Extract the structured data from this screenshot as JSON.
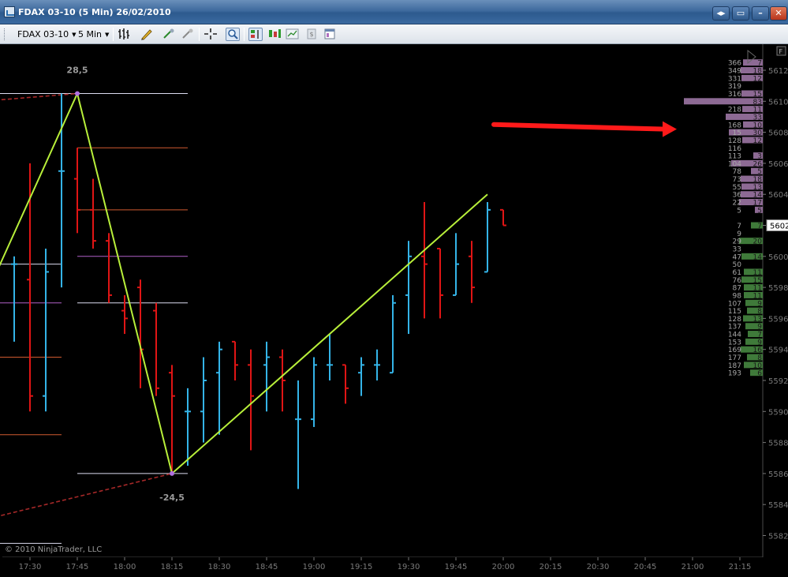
{
  "window": {
    "title": "FDAX 03-10 (5 Min)  26/02/2010",
    "buttons": [
      "◂▸",
      "▭",
      "–",
      "✕"
    ]
  },
  "toolbar": {
    "instrument": "FDAX 03-10",
    "interval": "5 Min"
  },
  "copyright": "© 2010 NinjaTrader, LLC",
  "colors": {
    "up_bar": "#34b4e8",
    "down_bar": "#e01515",
    "zigzag": "#b8ef3a",
    "trend_dash": "#a52828",
    "level_white": "#dcdcf0",
    "level_orange": "#d05a30",
    "level_purple": "#b060c8",
    "arrow": "#ff1a1a",
    "vol_ask": "#8d6a94",
    "vol_bid": "#3f7a3a",
    "axis_text": "#7a7a7a"
  },
  "chart_data": {
    "type": "bar",
    "style": "OHLC",
    "x_ticks": [
      "17:30",
      "17:45",
      "18:00",
      "18:15",
      "18:30",
      "18:45",
      "19:00",
      "19:15",
      "19:30",
      "19:45",
      "20:00",
      "20:15",
      "20:30",
      "20:45",
      "21:00",
      "21:15"
    ],
    "y_ticks": [
      "5612",
      "5610",
      "5608",
      "5606",
      "5604",
      "5602",
      "5600",
      "5598",
      "5596",
      "5594",
      "5592",
      "5590",
      "5588",
      "5586",
      "5584",
      "5582"
    ],
    "ylim": [
      5581.2,
      5612.7
    ],
    "current_price": "5602",
    "bars": [
      {
        "t": "17:25",
        "o": 5599.5,
        "h": 5600.0,
        "l": 5594.5,
        "c": 5599.5
      },
      {
        "t": "17:30",
        "o": 5598.5,
        "h": 5606.0,
        "l": 5590.0,
        "c": 5591.0
      },
      {
        "t": "17:35",
        "o": 5591.0,
        "h": 5600.5,
        "l": 5590.0,
        "c": 5599.0
      },
      {
        "t": "17:40",
        "o": 5605.5,
        "h": 5610.5,
        "l": 5598.0,
        "c": 5605.5
      },
      {
        "t": "17:45",
        "o": 5605.0,
        "h": 5607.0,
        "l": 5601.5,
        "c": 5603.0
      },
      {
        "t": "17:50",
        "o": 5603.0,
        "h": 5605.0,
        "l": 5600.5,
        "c": 5601.0
      },
      {
        "t": "17:55",
        "o": 5601.0,
        "h": 5601.5,
        "l": 5597.0,
        "c": 5597.5
      },
      {
        "t": "18:00",
        "o": 5596.5,
        "h": 5597.5,
        "l": 5595.0,
        "c": 5596.0
      },
      {
        "t": "18:05",
        "o": 5598.0,
        "h": 5598.5,
        "l": 5591.5,
        "c": 5594.0
      },
      {
        "t": "18:10",
        "o": 5596.5,
        "h": 5597.0,
        "l": 5591.0,
        "c": 5591.5
      },
      {
        "t": "18:15",
        "o": 5592.5,
        "h": 5593.0,
        "l": 5586.0,
        "c": 5591.0
      },
      {
        "t": "18:20",
        "o": 5590.0,
        "h": 5591.5,
        "l": 5586.5,
        "c": 5590.0
      },
      {
        "t": "18:25",
        "o": 5590.0,
        "h": 5593.5,
        "l": 5588.0,
        "c": 5592.0
      },
      {
        "t": "18:30",
        "o": 5592.5,
        "h": 5594.5,
        "l": 5588.5,
        "c": 5594.0
      },
      {
        "t": "18:35",
        "o": 5594.5,
        "h": 5594.5,
        "l": 5592.0,
        "c": 5593.0
      },
      {
        "t": "18:40",
        "o": 5593.0,
        "h": 5594.0,
        "l": 5587.5,
        "c": 5591.0
      },
      {
        "t": "18:45",
        "o": 5593.0,
        "h": 5594.5,
        "l": 5590.0,
        "c": 5593.5
      },
      {
        "t": "18:50",
        "o": 5593.5,
        "h": 5594.0,
        "l": 5590.0,
        "c": 5592.0
      },
      {
        "t": "18:55",
        "o": 5589.5,
        "h": 5592.0,
        "l": 5585.0,
        "c": 5589.5
      },
      {
        "t": "19:00",
        "o": 5589.5,
        "h": 5593.5,
        "l": 5589.0,
        "c": 5593.0
      },
      {
        "t": "19:05",
        "o": 5593.0,
        "h": 5595.0,
        "l": 5592.0,
        "c": 5593.0
      },
      {
        "t": "19:10",
        "o": 5593.0,
        "h": 5593.0,
        "l": 5590.5,
        "c": 5591.5
      },
      {
        "t": "19:15",
        "o": 5592.5,
        "h": 5593.5,
        "l": 5591.0,
        "c": 5593.0
      },
      {
        "t": "19:20",
        "o": 5593.0,
        "h": 5594.0,
        "l": 5592.0,
        "c": 5593.0
      },
      {
        "t": "19:25",
        "o": 5592.5,
        "h": 5597.5,
        "l": 5592.5,
        "c": 5597.0
      },
      {
        "t": "19:30",
        "o": 5597.5,
        "h": 5601.0,
        "l": 5595.0,
        "c": 5600.0
      },
      {
        "t": "19:35",
        "o": 5600.0,
        "h": 5603.5,
        "l": 5596.0,
        "c": 5599.5
      },
      {
        "t": "19:40",
        "o": 5600.5,
        "h": 5600.5,
        "l": 5596.0,
        "c": 5597.5
      },
      {
        "t": "19:45",
        "o": 5597.5,
        "h": 5601.5,
        "l": 5597.5,
        "c": 5599.5
      },
      {
        "t": "19:50",
        "o": 5600.0,
        "h": 5601.0,
        "l": 5597.0,
        "c": 5598.0
      },
      {
        "t": "19:55",
        "o": 5599.0,
        "h": 5603.5,
        "l": 5599.0,
        "c": 5603.0
      },
      {
        "t": "20:00",
        "o": 5603.0,
        "h": 5603.0,
        "l": 5602.0,
        "c": 5602.0
      }
    ],
    "zigzag": {
      "points": [
        [
          "17:15",
          5597.0
        ],
        [
          "17:45",
          5610.5
        ],
        [
          "18:15",
          5586.0
        ],
        [
          "19:55",
          5604.0
        ]
      ],
      "labels": [
        {
          "at": "17:45",
          "value": "28,5"
        },
        {
          "at": "18:15",
          "value": "-24,5"
        }
      ]
    },
    "levels": [
      {
        "price": 5610.5,
        "from": "17:15",
        "to": "18:20",
        "color": "white"
      },
      {
        "price": 5599.5,
        "from": "17:15",
        "to": "17:40",
        "color": "white"
      },
      {
        "price": 5597.0,
        "from": "17:15",
        "to": "17:40",
        "color": "purple"
      },
      {
        "price": 5593.5,
        "from": "17:15",
        "to": "17:40",
        "color": "orange"
      },
      {
        "price": 5588.5,
        "from": "17:15",
        "to": "17:40",
        "color": "orange"
      },
      {
        "price": 5581.5,
        "from": "17:15",
        "to": "17:40",
        "color": "white"
      },
      {
        "price": 5607.0,
        "from": "17:45",
        "to": "18:20",
        "color": "orange"
      },
      {
        "price": 5603.0,
        "from": "17:45",
        "to": "18:20",
        "color": "orange"
      },
      {
        "price": 5600.0,
        "from": "17:45",
        "to": "18:20",
        "color": "purple"
      },
      {
        "price": 5597.0,
        "from": "17:45",
        "to": "18:20",
        "color": "white"
      },
      {
        "price": 5586.0,
        "from": "17:45",
        "to": "18:20",
        "color": "white"
      }
    ],
    "trend_lines": [
      {
        "from": [
          "17:15",
          5610.0
        ],
        "to": [
          "17:45",
          5610.5
        ]
      },
      {
        "from": [
          "17:15",
          5583.0
        ],
        "to": [
          "18:15",
          5586.0
        ]
      }
    ],
    "volume_profile": [
      {
        "price": 5612.5,
        "total": "366",
        "side": "ask",
        "delta": "7",
        "bar": 0.25
      },
      {
        "price": 5612.0,
        "total": "349",
        "side": "ask",
        "delta": "18",
        "bar": 0.28
      },
      {
        "price": 5611.5,
        "total": "331",
        "side": "ask",
        "delta": "12",
        "bar": 0.27
      },
      {
        "price": 5611.0,
        "total": "319",
        "side": "ask",
        "delta": "",
        "bar": 0.0
      },
      {
        "price": 5610.5,
        "total": "316",
        "side": "ask",
        "delta": "15",
        "bar": 0.27
      },
      {
        "price": 5610.0,
        "total": "",
        "side": "ask",
        "delta": "83",
        "bar": 1.0
      },
      {
        "price": 5609.5,
        "total": "218",
        "side": "ask",
        "delta": "11",
        "bar": 0.26
      },
      {
        "price": 5609.0,
        "total": "",
        "side": "ask",
        "delta": "33",
        "bar": 0.47
      },
      {
        "price": 5608.5,
        "total": "168",
        "side": "ask",
        "delta": "10",
        "bar": 0.25
      },
      {
        "price": 5608.0,
        "total": "15",
        "side": "ask",
        "delta": "30",
        "bar": 0.43
      },
      {
        "price": 5607.5,
        "total": "128",
        "side": "ask",
        "delta": "12",
        "bar": 0.26
      },
      {
        "price": 5607.0,
        "total": "116",
        "side": "ask",
        "delta": "",
        "bar": 0.0
      },
      {
        "price": 5606.5,
        "total": "113",
        "side": "ask",
        "delta": "3",
        "bar": 0.12
      },
      {
        "price": 5606.0,
        "total": "104",
        "side": "ask",
        "delta": "26",
        "bar": 0.4
      },
      {
        "price": 5605.5,
        "total": "78",
        "side": "ask",
        "delta": "5",
        "bar": 0.15
      },
      {
        "price": 5605.0,
        "total": "73",
        "side": "ask",
        "delta": "18",
        "bar": 0.28
      },
      {
        "price": 5604.5,
        "total": "55",
        "side": "ask",
        "delta": "13",
        "bar": 0.27
      },
      {
        "price": 5604.0,
        "total": "36",
        "side": "ask",
        "delta": "14",
        "bar": 0.28
      },
      {
        "price": 5603.5,
        "total": "22",
        "side": "ask",
        "delta": "17",
        "bar": 0.3
      },
      {
        "price": 5603.0,
        "total": "5",
        "side": "ask",
        "delta": "5",
        "bar": 0.1
      },
      {
        "price": 5602.0,
        "total": "7",
        "side": "bid",
        "delta": "7",
        "bar": 0.15
      },
      {
        "price": 5601.5,
        "total": "9",
        "side": "bid",
        "delta": "",
        "bar": 0.0
      },
      {
        "price": 5601.0,
        "total": "29",
        "side": "bid",
        "delta": "20",
        "bar": 0.3
      },
      {
        "price": 5600.5,
        "total": "33",
        "side": "bid",
        "delta": "",
        "bar": 0.0
      },
      {
        "price": 5600.0,
        "total": "47",
        "side": "bid",
        "delta": "14",
        "bar": 0.27
      },
      {
        "price": 5599.5,
        "total": "50",
        "side": "bid",
        "delta": "",
        "bar": 0.0
      },
      {
        "price": 5599.0,
        "total": "61",
        "side": "bid",
        "delta": "11",
        "bar": 0.24
      },
      {
        "price": 5598.5,
        "total": "76",
        "side": "bid",
        "delta": "15",
        "bar": 0.27
      },
      {
        "price": 5598.0,
        "total": "87",
        "side": "bid",
        "delta": "11",
        "bar": 0.24
      },
      {
        "price": 5597.5,
        "total": "98",
        "side": "bid",
        "delta": "11",
        "bar": 0.24
      },
      {
        "price": 5597.0,
        "total": "107",
        "side": "bid",
        "delta": "9",
        "bar": 0.22
      },
      {
        "price": 5596.5,
        "total": "115",
        "side": "bid",
        "delta": "8",
        "bar": 0.2
      },
      {
        "price": 5596.0,
        "total": "128",
        "side": "bid",
        "delta": "13",
        "bar": 0.25
      },
      {
        "price": 5595.5,
        "total": "137",
        "side": "bid",
        "delta": "9",
        "bar": 0.22
      },
      {
        "price": 5595.0,
        "total": "144",
        "side": "bid",
        "delta": "7",
        "bar": 0.19
      },
      {
        "price": 5594.5,
        "total": "153",
        "side": "bid",
        "delta": "9",
        "bar": 0.22
      },
      {
        "price": 5594.0,
        "total": "169",
        "side": "bid",
        "delta": "16",
        "bar": 0.28
      },
      {
        "price": 5593.5,
        "total": "177",
        "side": "bid",
        "delta": "8",
        "bar": 0.2
      },
      {
        "price": 5593.0,
        "total": "187",
        "side": "bid",
        "delta": "10",
        "bar": 0.24
      },
      {
        "price": 5592.5,
        "total": "193",
        "side": "bid",
        "delta": "6",
        "bar": 0.16
      }
    ],
    "annotation_arrow": {
      "from": [
        "20:00",
        5608.5
      ],
      "to": [
        "20:55",
        5608.2
      ]
    }
  }
}
